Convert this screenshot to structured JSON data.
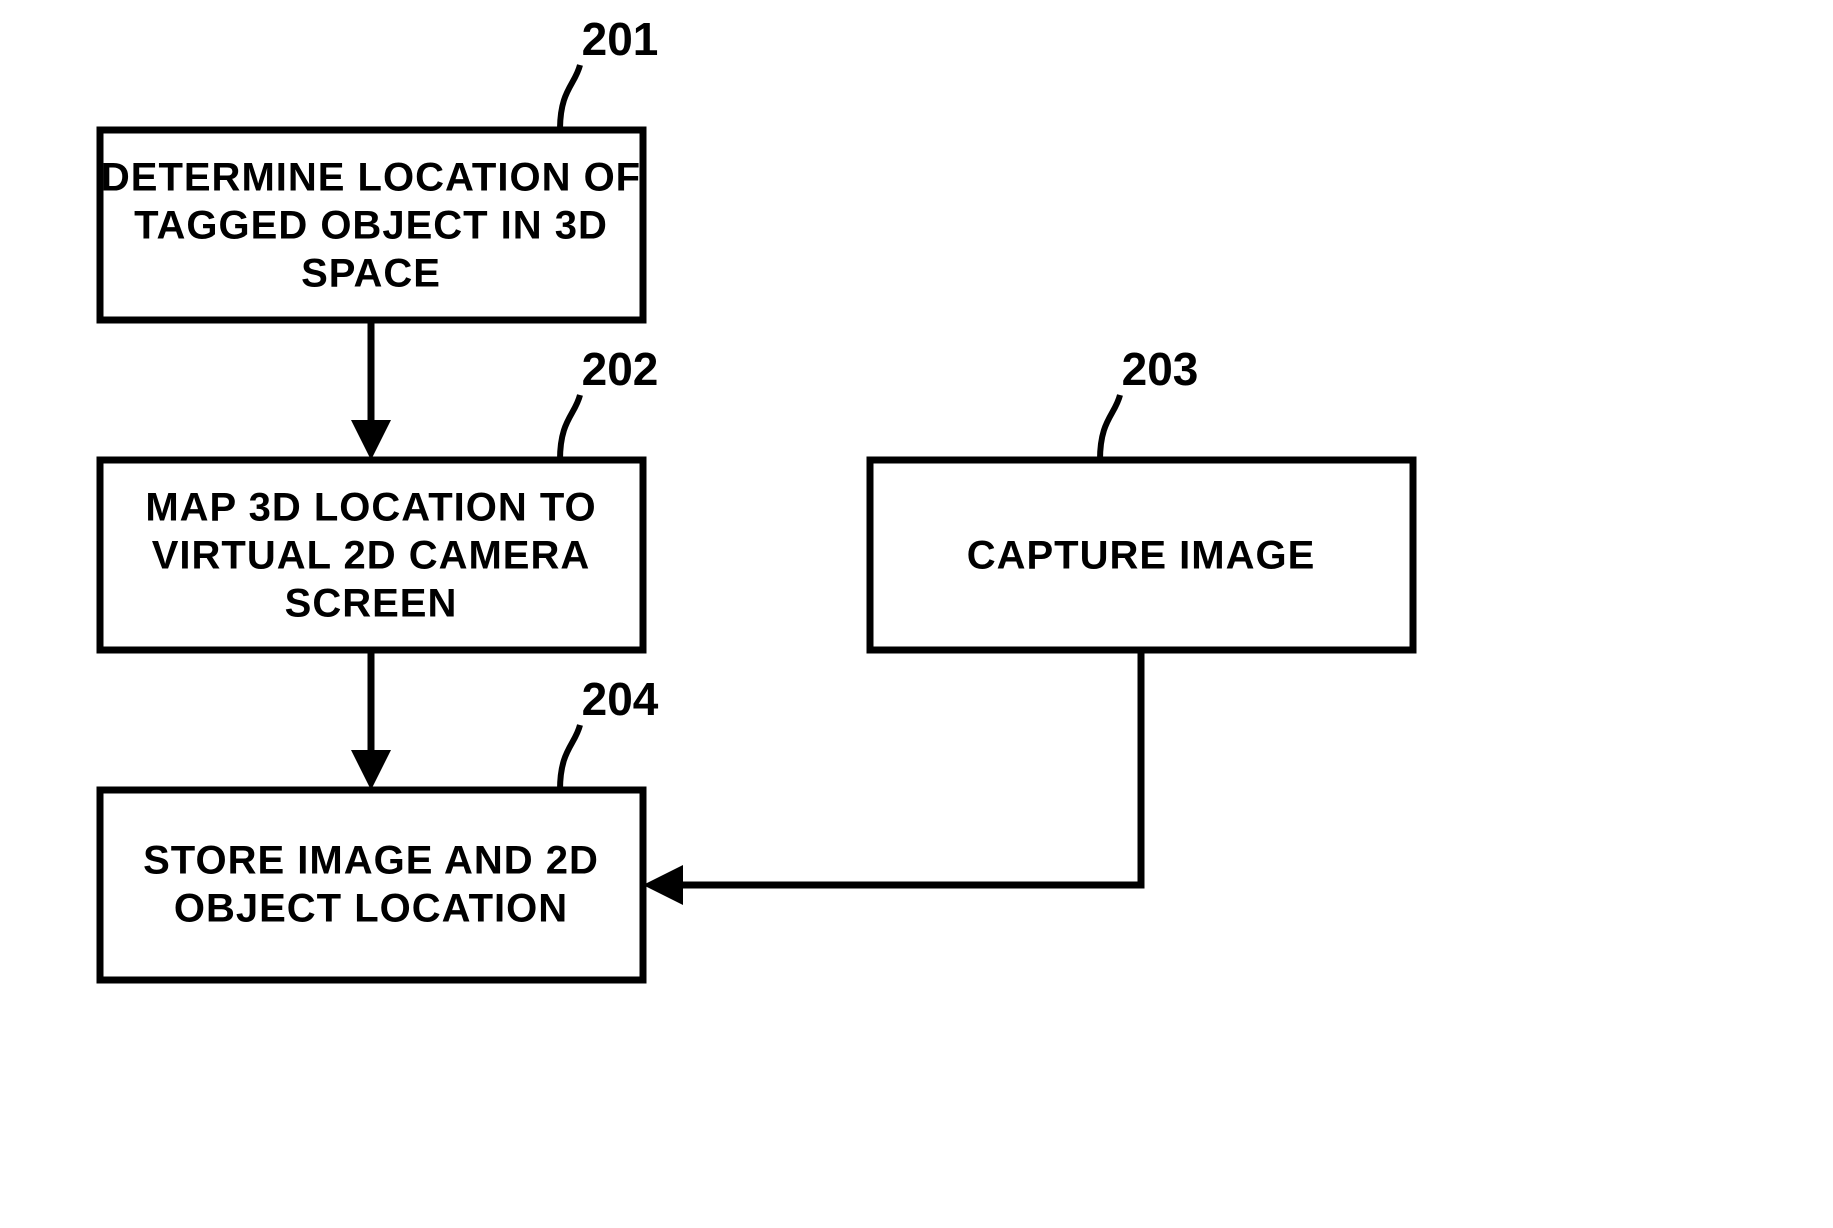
{
  "chart_data": {
    "type": "flowchart",
    "nodes": [
      {
        "id": "201",
        "ref": "201",
        "lines": [
          "DETERMINE LOCATION OF",
          "TAGGED OBJECT IN 3D",
          "SPACE"
        ]
      },
      {
        "id": "202",
        "ref": "202",
        "lines": [
          "MAP 3D LOCATION TO",
          "VIRTUAL 2D CAMERA",
          "SCREEN"
        ]
      },
      {
        "id": "203",
        "ref": "203",
        "lines": [
          "CAPTURE IMAGE"
        ]
      },
      {
        "id": "204",
        "ref": "204",
        "lines": [
          "STORE IMAGE AND 2D",
          "OBJECT LOCATION"
        ]
      }
    ],
    "edges": [
      {
        "from": "201",
        "to": "202"
      },
      {
        "from": "202",
        "to": "204"
      },
      {
        "from": "203",
        "to": "204"
      }
    ]
  },
  "refs": {
    "n201": "201",
    "n202": "202",
    "n203": "203",
    "n204": "204"
  },
  "labels": {
    "n201_l1": "DETERMINE LOCATION OF",
    "n201_l2": "TAGGED OBJECT IN 3D",
    "n201_l3": "SPACE",
    "n202_l1": "MAP 3D LOCATION TO",
    "n202_l2": "VIRTUAL 2D CAMERA",
    "n202_l3": "SCREEN",
    "n203_l1": "CAPTURE IMAGE",
    "n204_l1": "STORE IMAGE AND 2D",
    "n204_l2": "OBJECT LOCATION"
  }
}
